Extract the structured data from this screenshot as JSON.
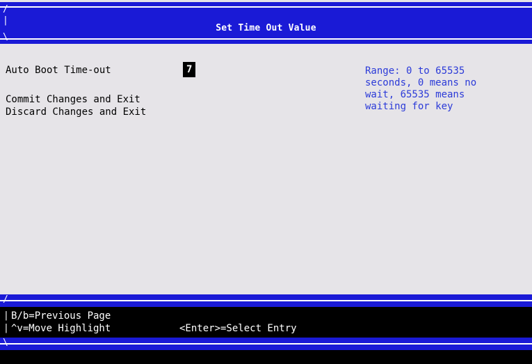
{
  "header": {
    "title": "Set Time Out Value"
  },
  "menu": {
    "auto_boot_label": "Auto Boot Time-out",
    "auto_boot_value": "7",
    "commit_label": "Commit Changes and Exit",
    "discard_label": "Discard Changes and Exit"
  },
  "help": {
    "lines": [
      "Range: 0 to 65535",
      "seconds, 0 means no",
      "wait, 65535 means",
      "waiting for key"
    ]
  },
  "footer": {
    "hint_prev": "B/b=Previous Page",
    "hint_move": "^v=Move Highlight",
    "hint_select": "<Enter>=Select Entry"
  },
  "colors": {
    "bar_blue": "#1a1ad6",
    "panel_bg": "#e6e4e8",
    "help_text": "#2b3ad8",
    "footer_bg": "#000000"
  }
}
